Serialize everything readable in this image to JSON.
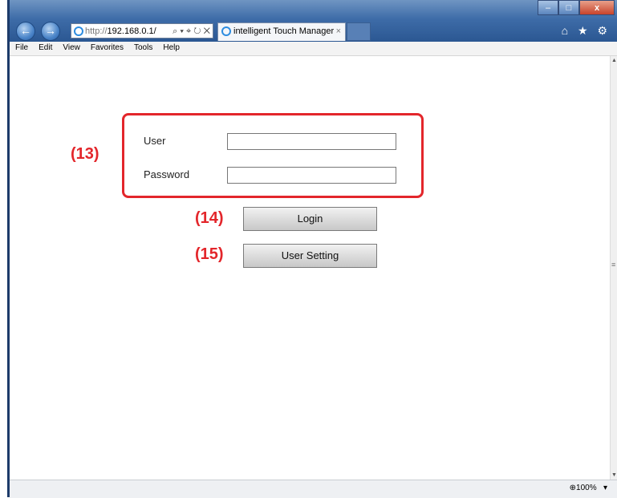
{
  "browser": {
    "address": {
      "prefix": "http://",
      "host": "192.168.0.1/",
      "controls": "⌕ ▾ ⌖ ↻ ✕"
    },
    "tab": {
      "title": "intelligent Touch Manager",
      "close": "×"
    },
    "window_buttons": {
      "minimize": "–",
      "maximize": "□",
      "close": "x"
    },
    "toolbar_glyphs": "⌂ ★ ⚙",
    "back": "←",
    "forward": "→"
  },
  "menu": [
    "File",
    "Edit",
    "View",
    "Favorites",
    "Tools",
    "Help"
  ],
  "login_form": {
    "user_label": "User",
    "password_label": "Password",
    "user_value": "",
    "password_value": "",
    "login_button": "Login",
    "user_setting_button": "User Setting"
  },
  "annotations": {
    "form": "(13)",
    "login": "(14)",
    "user_setting": "(15)"
  },
  "status": {
    "zoom": "⊕100%",
    "zoom_dropdown": "▾"
  },
  "colors": {
    "annotation_red": "#e3262b",
    "title_blue": "#3e6ca8"
  }
}
